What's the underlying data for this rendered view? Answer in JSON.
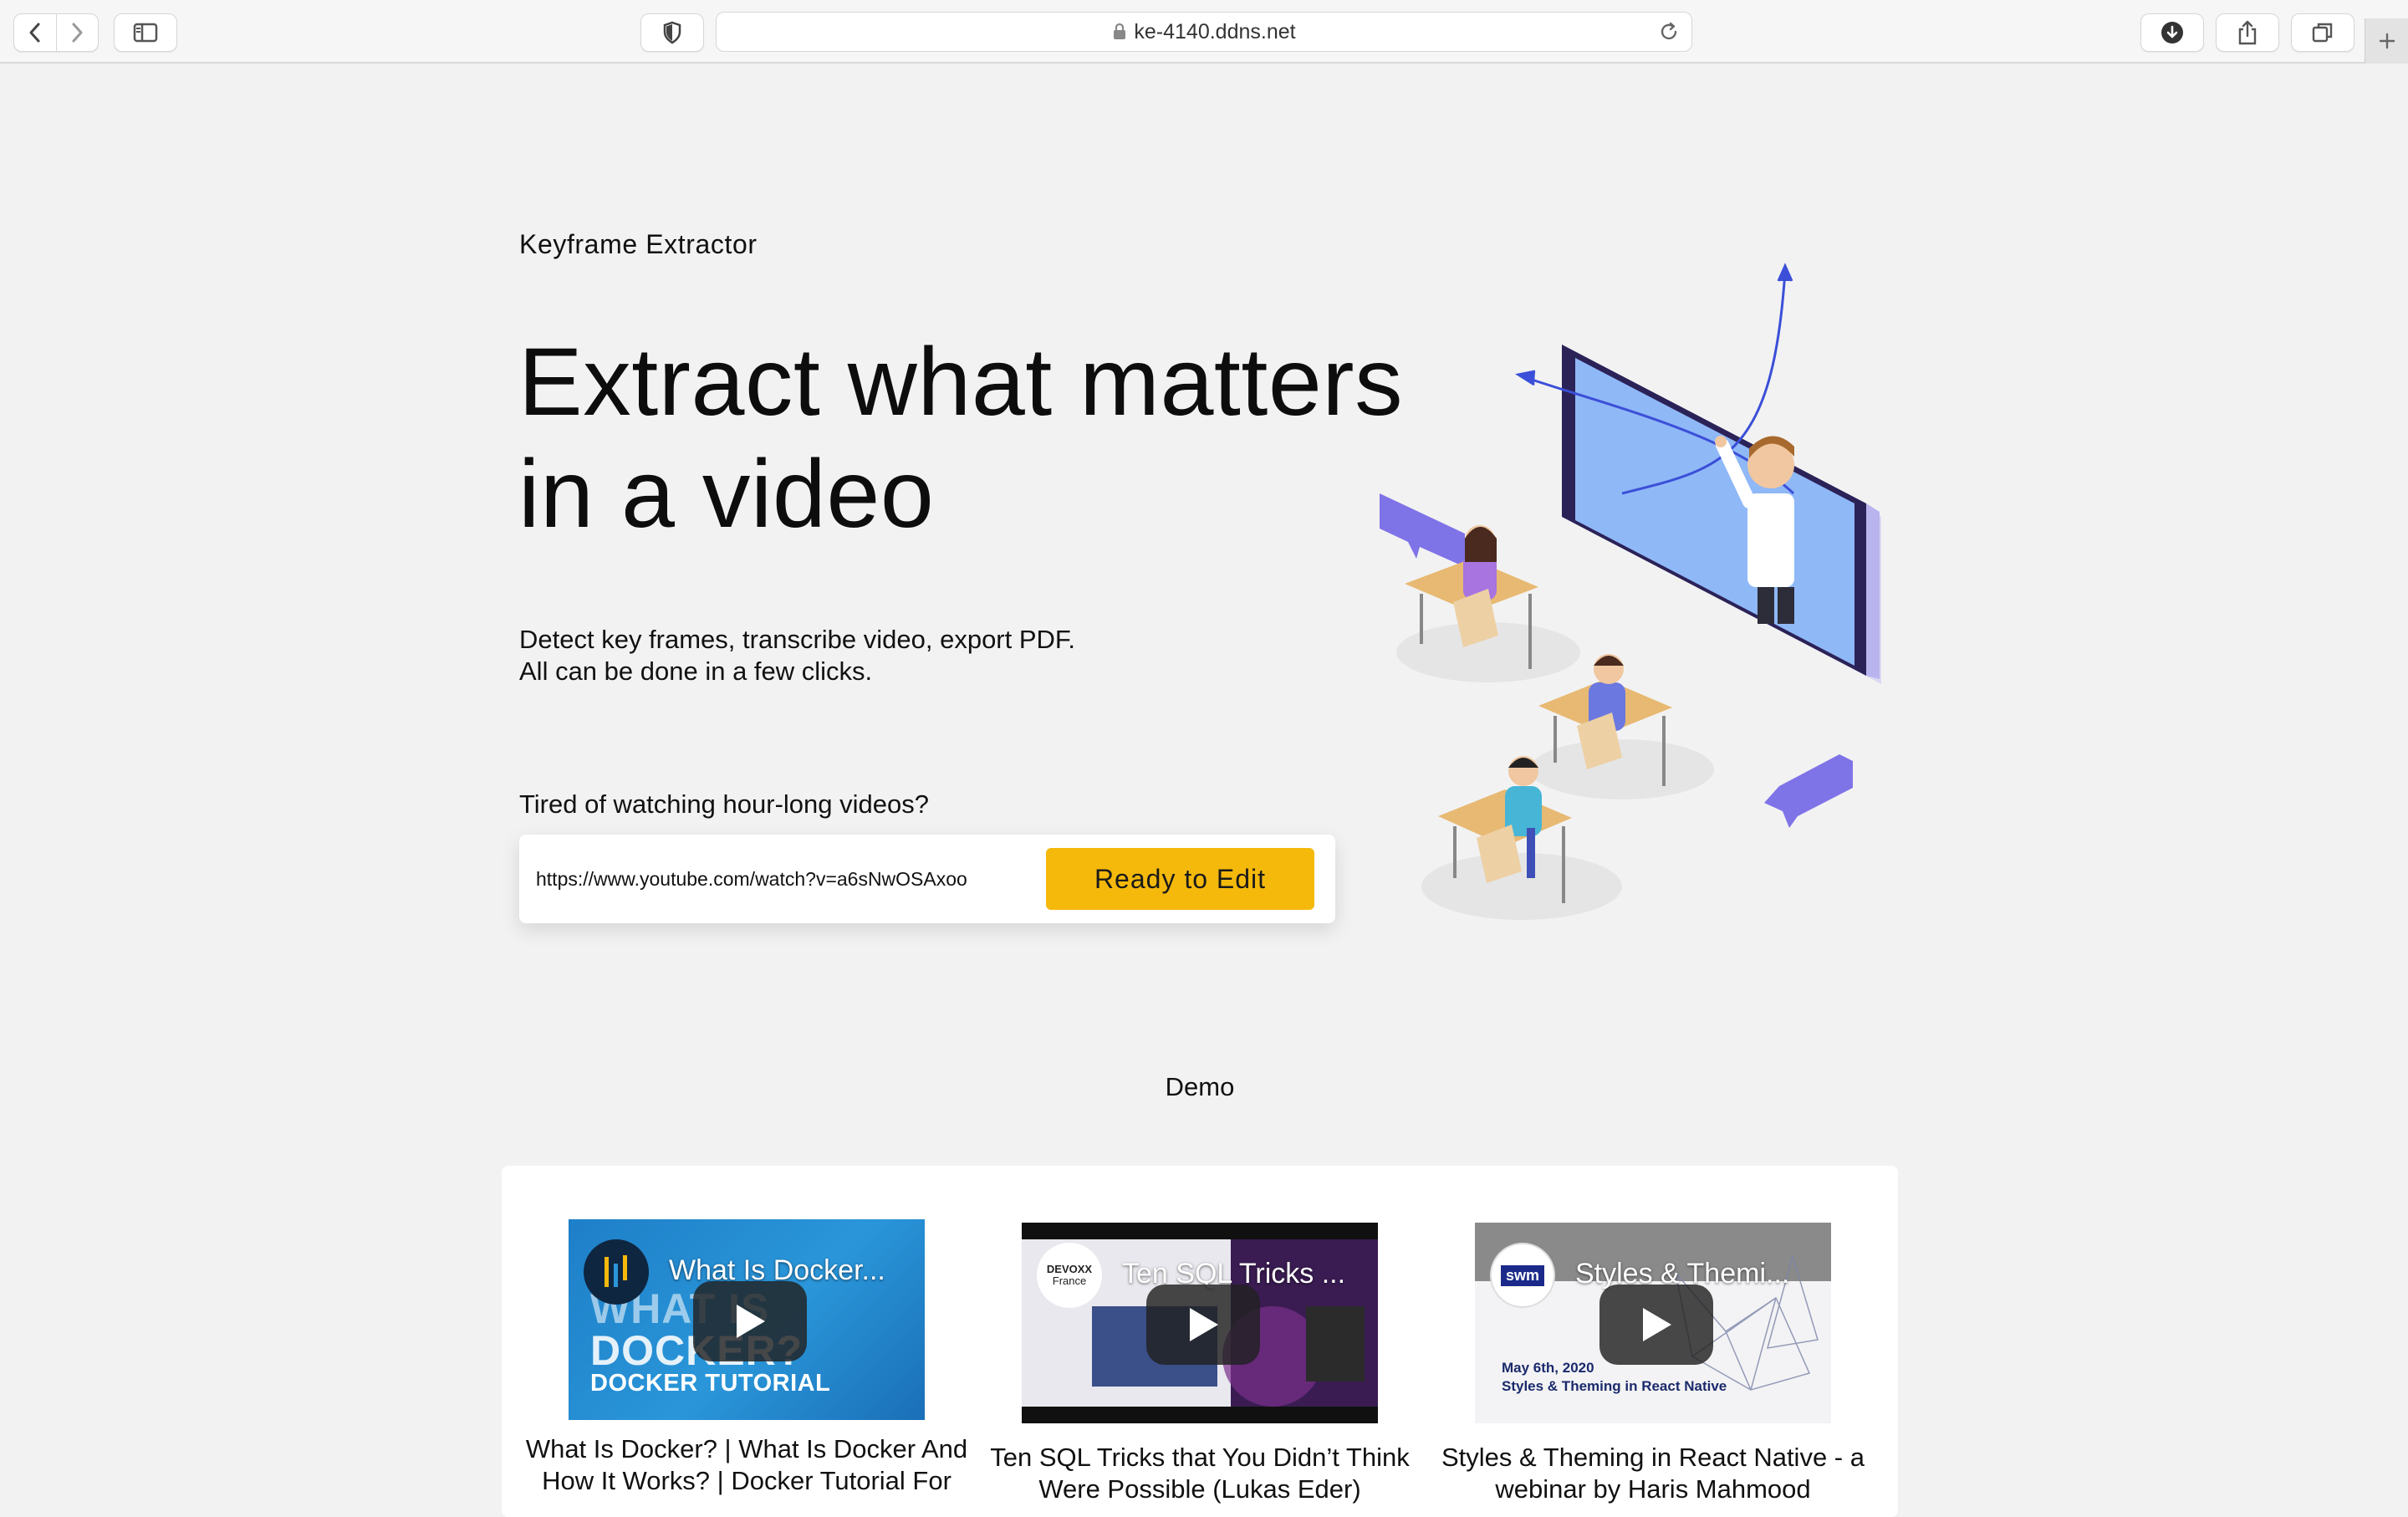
{
  "browser": {
    "url": "ke-4140.ddns.net"
  },
  "hero": {
    "brand": "Keyframe Extractor",
    "headline_line1": "Extract what matters",
    "headline_line2": "in a video",
    "sub_line1": "Detect key frames, transcribe video, export PDF.",
    "sub_line2": "All can be done in a few clicks.",
    "prompt": "Tired of watching hour-long videos?",
    "input_value": "https://www.youtube.com/watch?v=a6sNwOSAxoo",
    "button_label": "Ready to Edit"
  },
  "demo": {
    "title": "Demo",
    "videos": [
      {
        "thumb_title": "What Is Docker...",
        "thumb_text1": "WHAT IS",
        "thumb_text2": "DOCKER?",
        "thumb_text3": "DOCKER TUTORIAL",
        "caption_line1": "What Is Docker? | What Is Docker And",
        "caption_line2": "How It Works? | Docker Tutorial For"
      },
      {
        "thumb_title": "Ten SQL Tricks ...",
        "logo_text1": "DEVOXX",
        "logo_text2": "France",
        "caption_line1": "Ten SQL Tricks that You Didn’t Think",
        "caption_line2": "Were Possible (Lukas Eder)"
      },
      {
        "thumb_title": "Styles & Themi...",
        "logo_text": "swm",
        "thumb_line1": "May 6th, 2020",
        "thumb_line2": "Styles & Theming in React Native",
        "caption_line1": "Styles & Theming in React Native - a",
        "caption_line2": "webinar by Haris Mahmood"
      }
    ]
  },
  "colors": {
    "accent": "#f5b90c",
    "page_bg": "#f2f2f2"
  }
}
